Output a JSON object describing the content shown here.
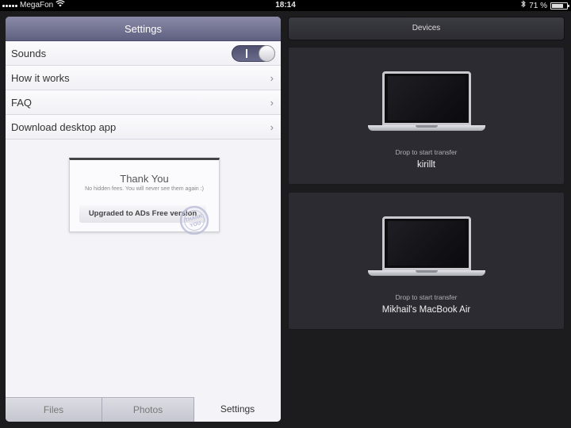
{
  "status_bar": {
    "carrier": "MegaFon",
    "time": "18:14",
    "battery": "71 %",
    "battery_level": 0.71
  },
  "settings": {
    "title": "Settings",
    "sounds_label": "Sounds",
    "sounds_on": true,
    "rows": [
      "How it works",
      "FAQ",
      "Download desktop app"
    ],
    "thanks": {
      "title": "Thank You",
      "subtitle": "No hidden fees. You will never see them again :)",
      "button": "Upgraded to ADs Free version",
      "stamp_text": "THANK YOU"
    }
  },
  "tabs": {
    "files": "Files",
    "photos": "Photos",
    "settings": "Settings",
    "active": "settings"
  },
  "devices": {
    "title": "Devices",
    "items": [
      {
        "drop_text": "Drop to start transfer",
        "name": "kirillt"
      },
      {
        "drop_text": "Drop to start transfer",
        "name": "Mikhail's MacBook Air"
      }
    ]
  },
  "colors": {
    "header_purple": "#6f6f92",
    "panel_bg": "#f4f4f8",
    "devices_bg": "#2b2b31"
  }
}
